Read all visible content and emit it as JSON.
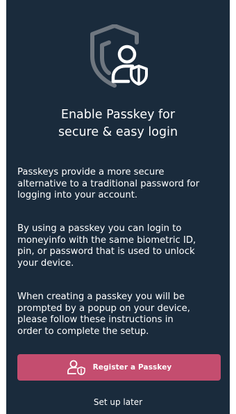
{
  "title": {
    "line1": "Enable Passkey for",
    "line2": "secure & easy login"
  },
  "paragraphs": [
    [
      "Passkeys provide a more secure",
      "alternative to a traditional password for",
      "logging into your account."
    ],
    [
      "By using a passkey you can login to",
      "moneyinfo with the same biometric ID,",
      "pin, or password that is used to unlock",
      "your device."
    ],
    [
      "When creating a passkey you will be",
      "prompted by a popup on your device,",
      "please follow these instructions in",
      "order to complete the setup."
    ]
  ],
  "register_button": {
    "label": "Register a Passkey",
    "icon": "user-shield-icon"
  },
  "later_link": "Set up later",
  "hero_icon": "passkey-shield-user-icon",
  "colors": {
    "background": "#1a2b3c",
    "button": "#c44d6f",
    "text": "#ffffff",
    "icon_muted": "#6f7780"
  }
}
